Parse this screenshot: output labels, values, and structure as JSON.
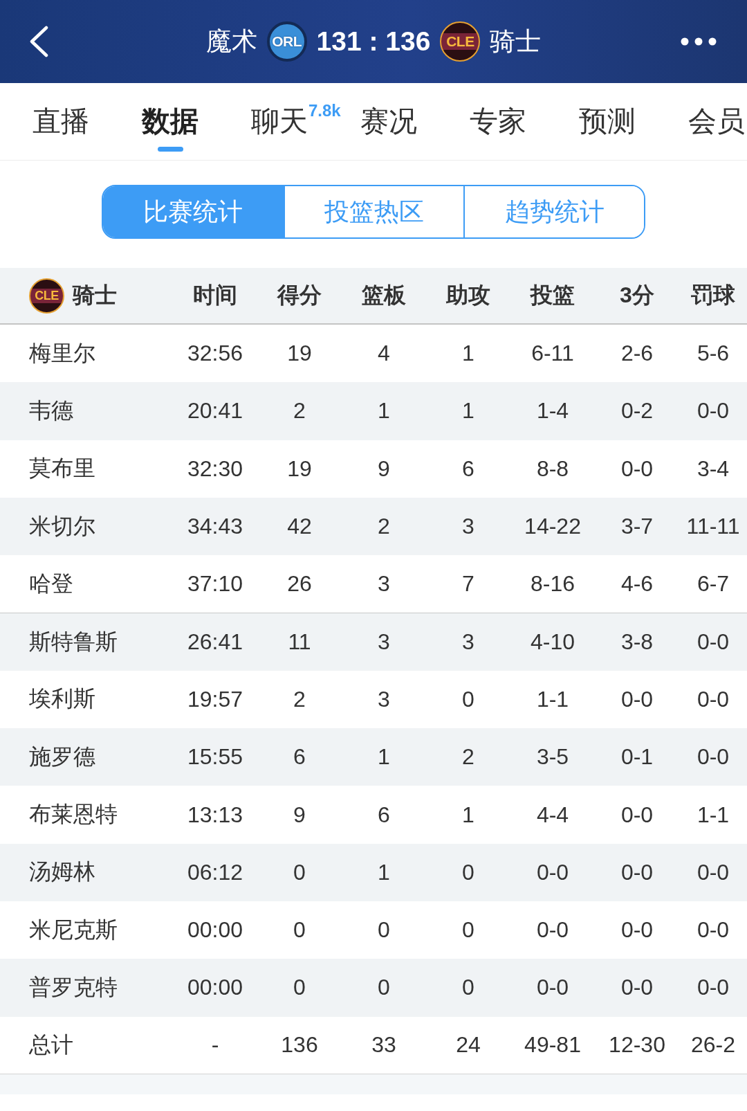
{
  "header": {
    "home_team": "魔术",
    "home_logo": "ORL",
    "score": "131 : 136",
    "away_logo": "CLE",
    "away_team": "骑士"
  },
  "tabs": [
    {
      "label": "直播",
      "selected": false
    },
    {
      "label": "数据",
      "selected": true
    },
    {
      "label": "聊天",
      "badge": "7.8k",
      "selected": false
    },
    {
      "label": "赛况",
      "selected": false
    },
    {
      "label": "专家",
      "selected": false
    },
    {
      "label": "预测",
      "selected": false
    },
    {
      "label": "会员",
      "selected": false
    }
  ],
  "segments": [
    {
      "label": "比赛统计",
      "selected": true
    },
    {
      "label": "投篮热区",
      "selected": false
    },
    {
      "label": "趋势统计",
      "selected": false
    }
  ],
  "table": {
    "team_logo": "CLE",
    "team": "骑士",
    "columns": [
      "时间",
      "得分",
      "篮板",
      "助攻",
      "投篮",
      "3分",
      "罚球"
    ],
    "groups": [
      {
        "rows": [
          {
            "name": "梅里尔",
            "cells": [
              "32:56",
              "19",
              "4",
              "1",
              "6-11",
              "2-6",
              "5-6"
            ]
          },
          {
            "name": "韦德",
            "cells": [
              "20:41",
              "2",
              "1",
              "1",
              "1-4",
              "0-2",
              "0-0"
            ]
          },
          {
            "name": "莫布里",
            "cells": [
              "32:30",
              "19",
              "9",
              "6",
              "8-8",
              "0-0",
              "3-4"
            ]
          },
          {
            "name": "米切尔",
            "cells": [
              "34:43",
              "42",
              "2",
              "3",
              "14-22",
              "3-7",
              "11-11"
            ]
          },
          {
            "name": "哈登",
            "cells": [
              "37:10",
              "26",
              "3",
              "7",
              "8-16",
              "4-6",
              "6-7"
            ]
          }
        ]
      },
      {
        "rows": [
          {
            "name": "斯特鲁斯",
            "cells": [
              "26:41",
              "11",
              "3",
              "3",
              "4-10",
              "3-8",
              "0-0"
            ]
          },
          {
            "name": "埃利斯",
            "cells": [
              "19:57",
              "2",
              "3",
              "0",
              "1-1",
              "0-0",
              "0-0"
            ]
          },
          {
            "name": "施罗德",
            "cells": [
              "15:55",
              "6",
              "1",
              "2",
              "3-5",
              "0-1",
              "0-0"
            ]
          },
          {
            "name": "布莱恩特",
            "cells": [
              "13:13",
              "9",
              "6",
              "1",
              "4-4",
              "0-0",
              "1-1"
            ]
          },
          {
            "name": "汤姆林",
            "cells": [
              "06:12",
              "0",
              "1",
              "0",
              "0-0",
              "0-0",
              "0-0"
            ]
          },
          {
            "name": "米尼克斯",
            "cells": [
              "00:00",
              "0",
              "0",
              "0",
              "0-0",
              "0-0",
              "0-0"
            ]
          },
          {
            "name": "普罗克特",
            "cells": [
              "00:00",
              "0",
              "0",
              "0",
              "0-0",
              "0-0",
              "0-0"
            ]
          }
        ]
      }
    ],
    "total": {
      "name": "总计",
      "cells": [
        "-",
        "136",
        "33",
        "24",
        "49-81",
        "12-30",
        "26-2"
      ]
    }
  }
}
